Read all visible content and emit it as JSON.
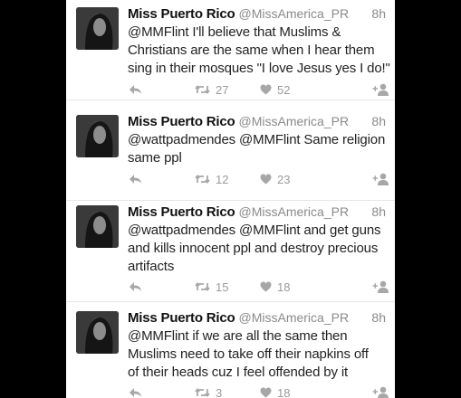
{
  "tweets": [
    {
      "name": "Miss Puerto Rico",
      "handle": "@MissAmerica_PR",
      "time": "8h",
      "lines": [
        "@MMFlint I'll believe that Muslims &",
        "Christians are the same when I hear them",
        "sing in their mosques \"I love Jesus yes I do!\""
      ],
      "retweets": "27",
      "likes": "52"
    },
    {
      "name": "Miss Puerto Rico",
      "handle": "@MissAmerica_PR",
      "time": "8h",
      "lines": [
        "@wattpadmendes @MMFlint Same religion",
        "same ppl"
      ],
      "retweets": "12",
      "likes": "23"
    },
    {
      "name": "Miss Puerto Rico",
      "handle": "@MissAmerica_PR",
      "time": "8h",
      "lines": [
        "@wattpadmendes @MMFlint and get guns",
        "and kills innocent ppl and destroy precious",
        "artifacts"
      ],
      "retweets": "15",
      "likes": "18"
    },
    {
      "name": "Miss Puerto Rico",
      "handle": "@MissAmerica_PR",
      "time": "8h",
      "lines": [
        "@MMFlint if we are all the same then",
        "Muslims need to take off their napkins off",
        "of their heads cuz I feel offended by it"
      ],
      "retweets": "3",
      "likes": "18"
    }
  ],
  "icons": {
    "reply": "reply-icon",
    "retweet": "retweet-icon",
    "like": "heart-icon",
    "follow": "follow-icon"
  },
  "colors": {
    "background": "#000000",
    "card": "#ffffff",
    "name": "#111111",
    "muted": "#8a8a8a"
  }
}
